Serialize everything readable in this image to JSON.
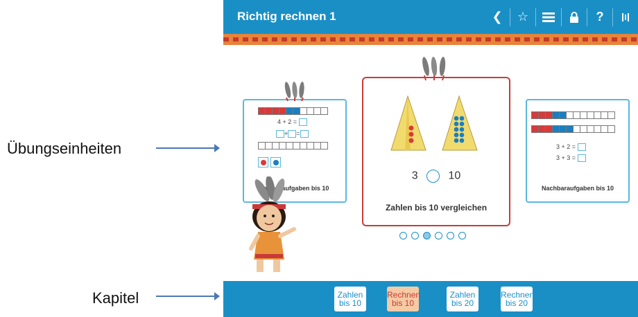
{
  "annotations": {
    "exercises": "Übungseinheiten",
    "chapter": "Kapitel"
  },
  "app": {
    "title": "Richtig rechnen 1",
    "toolbar_icons": [
      "back-icon",
      "star-icon",
      "menu-icon",
      "lock-icon",
      "help-icon",
      "settings-icon"
    ]
  },
  "cards": {
    "left": {
      "label": "Tauschaufgaben bis 10",
      "equation": "4 + 2 ="
    },
    "center": {
      "label": "Zahlen bis 10 vergleichen",
      "left_number": "3",
      "right_number": "10"
    },
    "right": {
      "label": "Nachbaraufgaben bis 10",
      "equation1": "3 + 2 =",
      "equation2": "3 + 3 ="
    }
  },
  "pagination": {
    "count": 6,
    "active_index": 2
  },
  "chapters": [
    {
      "line1": "Zahlen",
      "line2": "bis 10"
    },
    {
      "line1": "Rechnen",
      "line2": "bis 10"
    },
    {
      "line1": "Zahlen",
      "line2": "bis 20"
    },
    {
      "line1": "Rechnen",
      "line2": "bis 20"
    }
  ],
  "colors": {
    "primary": "#1a8fc6",
    "accent_red": "#c83a3a",
    "chapter_active_bg": "#f5caa4",
    "ribbon": "#e8833a"
  }
}
